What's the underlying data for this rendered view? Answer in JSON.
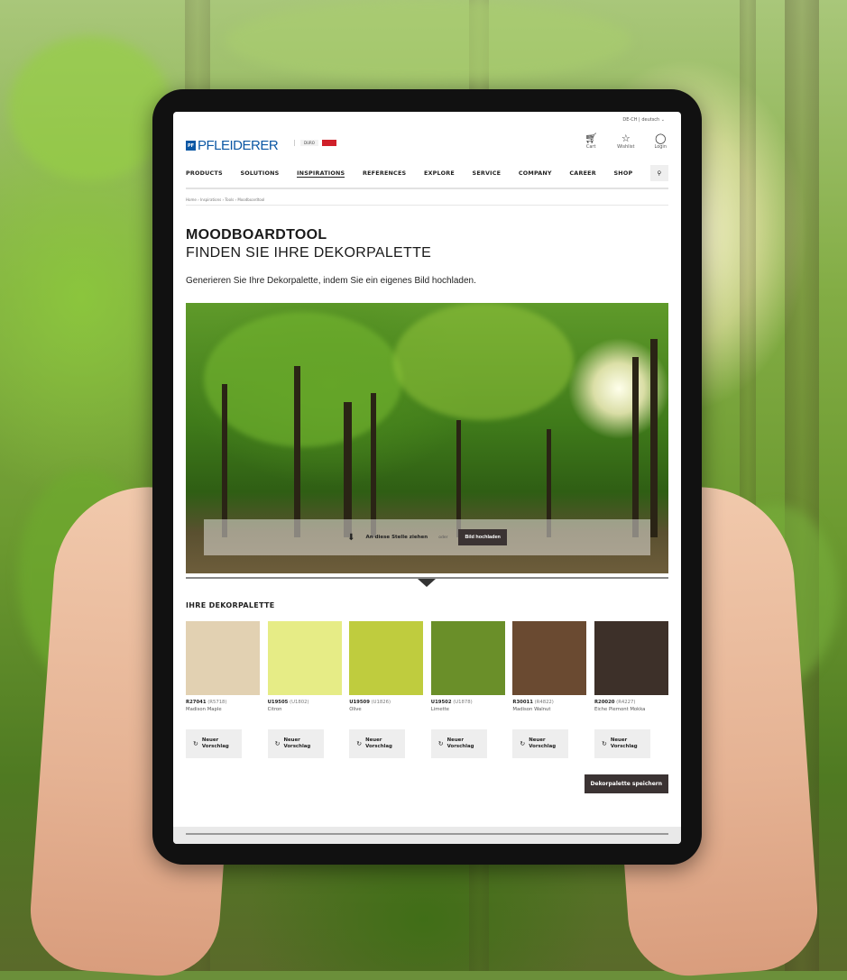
{
  "header": {
    "language": "DE-CH | deutsch ⌄",
    "logo_mark": "PF",
    "logo_text": "PFLEIDERER",
    "brand_chips": [
      "DURO",
      ""
    ],
    "icons": [
      {
        "icon": "cart-icon",
        "label": "Cart"
      },
      {
        "icon": "star-icon",
        "label": "Wishlist"
      },
      {
        "icon": "user-icon",
        "label": "Login"
      }
    ]
  },
  "nav": {
    "items": [
      "PRODUCTS",
      "SOLUTIONS",
      "INSPIRATIONS",
      "REFERENCES",
      "EXPLORE",
      "SERVICE",
      "COMPANY",
      "CAREER",
      "SHOP"
    ],
    "active": "INSPIRATIONS"
  },
  "breadcrumb": "Home › Inspirations › Tools › Moodboardtool",
  "page": {
    "title": "MOODBOARDTOOL",
    "subtitle": "FINDEN SIE IHRE DEKORPALETTE",
    "intro": "Generieren Sie Ihre Dekorpalette, indem Sie ein eigenes Bild hochladen."
  },
  "upload": {
    "drop_label": "An diese Stelle ziehen",
    "or_label": "oder",
    "button_label": "Bild hochladen"
  },
  "palette": {
    "title": "IHRE DEKORPALETTE",
    "new_label_1": "Neuer",
    "new_label_2": "Vorschlag",
    "swatches": [
      {
        "code": "R27041",
        "alt": "(R5718)",
        "name": "Madison Maple",
        "color": "#e2d1b2"
      },
      {
        "code": "U19505",
        "alt": "(U1802)",
        "name": "Citron",
        "color": "#e6ec86"
      },
      {
        "code": "U19509",
        "alt": "(U1826)",
        "name": "Olive",
        "color": "#bfcc3e"
      },
      {
        "code": "U19502",
        "alt": "(U1878)",
        "name": "Limette",
        "color": "#6a8f29"
      },
      {
        "code": "R30011",
        "alt": "(R4822)",
        "name": "Madison Walnut",
        "color": "#6a4a31"
      },
      {
        "code": "R20020",
        "alt": "(R4227)",
        "name": "Eiche Piemont Mokka",
        "color": "#3d3029"
      }
    ],
    "save_label": "Dekorpalette speichern"
  }
}
